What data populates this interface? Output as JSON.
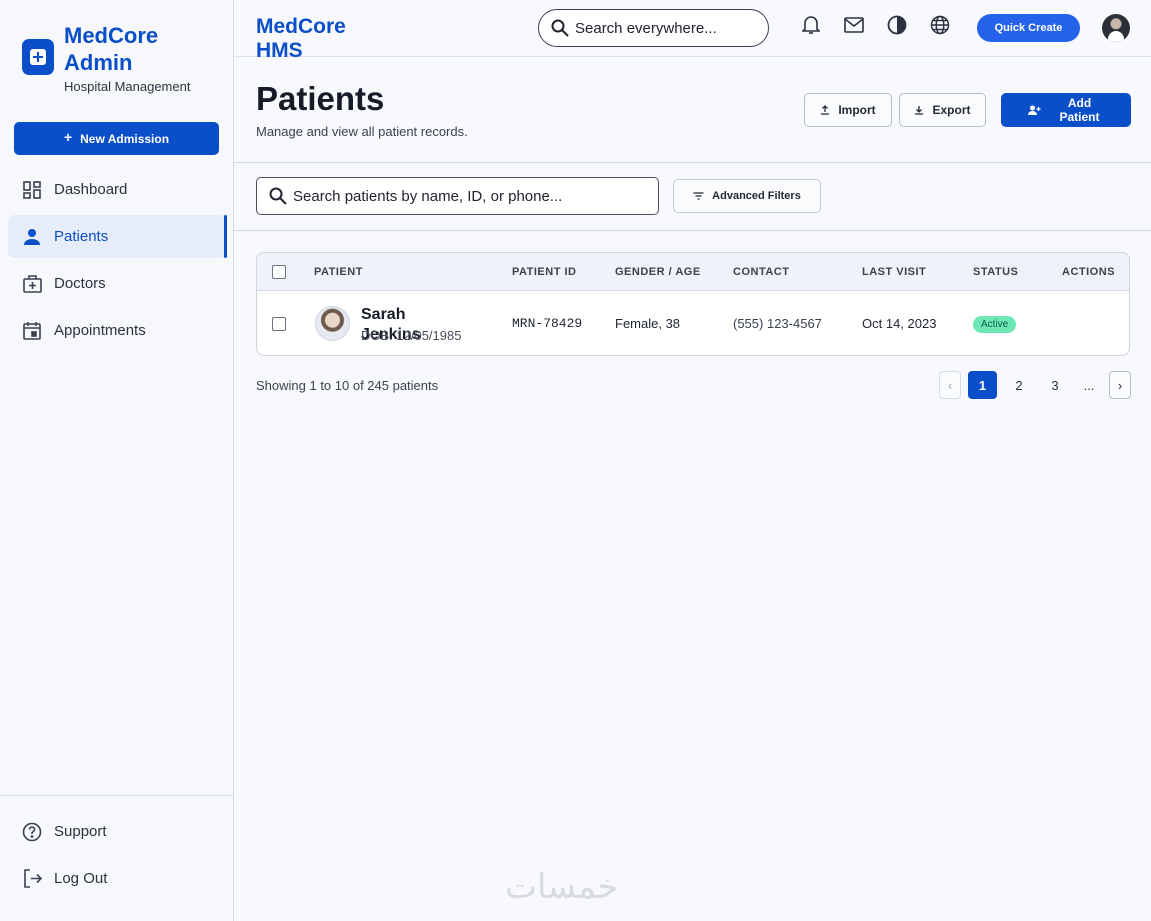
{
  "sidebar": {
    "title": "MedCore Admin",
    "subtitle": "Hospital Management",
    "new_admission": "New Admission",
    "items": [
      {
        "label": "Dashboard",
        "icon": "dashboard-icon"
      },
      {
        "label": "Patients",
        "icon": "person-icon",
        "active": true
      },
      {
        "label": "Doctors",
        "icon": "medical-bag-icon"
      },
      {
        "label": "Appointments",
        "icon": "calendar-icon"
      }
    ],
    "bottom_items": [
      {
        "label": "Support",
        "icon": "help-icon"
      },
      {
        "label": "Log Out",
        "icon": "logout-icon"
      }
    ]
  },
  "topbar": {
    "brand": "MedCore HMS",
    "search_placeholder": "Search everywhere...",
    "quick_create": "Quick Create"
  },
  "header": {
    "title": "Patients",
    "subtitle": "Manage and view all patient records.",
    "import": "Import",
    "export": "Export",
    "add_patient": "Add Patient"
  },
  "filters": {
    "search_placeholder": "Search patients by name, ID, or phone...",
    "advanced": "Advanced Filters"
  },
  "table": {
    "headers": [
      "PATIENT",
      "PATIENT ID",
      "GENDER / AGE",
      "CONTACT",
      "LAST VISIT",
      "STATUS",
      "ACTIONS"
    ],
    "rows": [
      {
        "name": "Sarah Jenkins",
        "dob": "DOB: 12/05/1985",
        "id": "MRN-78429",
        "gender_age": "Female, 38",
        "contact": "(555) 123-4567",
        "last_visit": "Oct 14, 2023",
        "status": "Active"
      }
    ]
  },
  "pagination": {
    "showing": "Showing 1 to 10 of 245 patients",
    "prev": "‹",
    "pages": [
      "1",
      "2",
      "3"
    ],
    "dots": "...",
    "next": "›"
  },
  "colors": {
    "primary": "#0a4fc9",
    "active_badge": "#6ee7b7"
  },
  "watermark": "خمسات"
}
